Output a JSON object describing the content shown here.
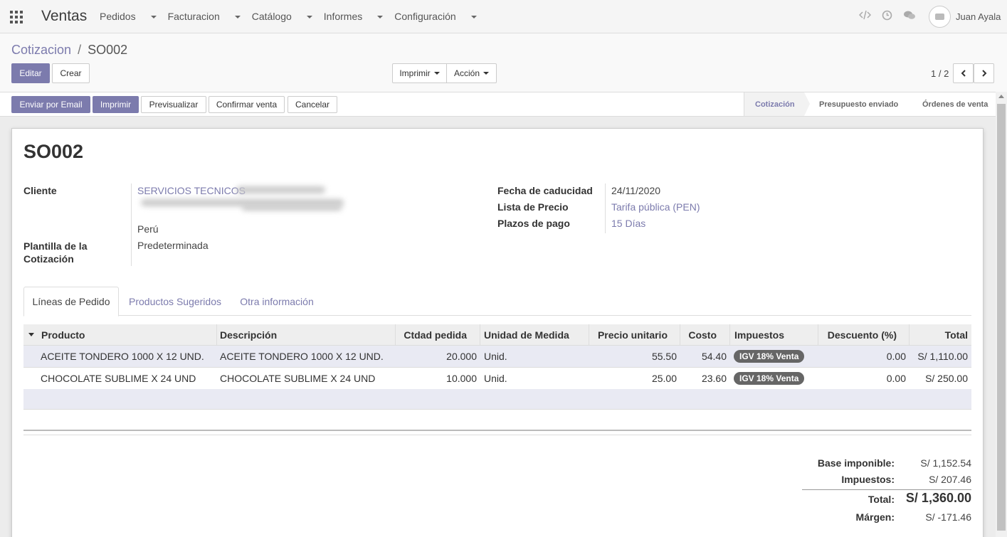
{
  "topbar": {
    "app_name": "Ventas",
    "menu": [
      "Pedidos",
      "Facturacion",
      "Catálogo",
      "Informes",
      "Configuración"
    ],
    "icons": [
      "code-icon",
      "clock-icon",
      "chat-icon"
    ],
    "user_name": "Juan Ayala"
  },
  "breadcrumb": {
    "parent": "Cotizacion",
    "separator": "/",
    "current": "SO002"
  },
  "controls": {
    "edit": "Editar",
    "create": "Crear",
    "print_menu": "Imprimir",
    "action_menu": "Acción",
    "pager": "1 / 2"
  },
  "statusbar": {
    "buttons": [
      "Enviar por Email",
      "Imprimir",
      "Previsualizar",
      "Confirmar venta",
      "Cancelar"
    ],
    "stages": [
      "Cotización",
      "Presupuesto enviado",
      "Órdenes de venta"
    ],
    "active_stage": "Cotización"
  },
  "form": {
    "title": "SO002",
    "client_label": "Cliente",
    "client_name": "SERVICIOS TECNICOS",
    "client_country": "Perú",
    "template_label": "Plantilla de la Cotización",
    "template_value": "Predeterminada",
    "expiry_label": "Fecha de caducidad",
    "expiry_value": "24/11/2020",
    "pricelist_label": "Lista de Precio",
    "pricelist_value": "Tarifa pública (PEN)",
    "payment_terms_label": "Plazos de pago",
    "payment_terms_value": "15 Días"
  },
  "tabs": [
    "Líneas de Pedido",
    "Productos Sugeridos",
    "Otra información"
  ],
  "table": {
    "headers": [
      "Producto",
      "Descripción",
      "Ctdad pedida",
      "Unidad de Medida",
      "Precio unitario",
      "Costo",
      "Impuestos",
      "Descuento (%)",
      "Total"
    ],
    "rows": [
      {
        "product": "ACEITE TONDERO 1000 X 12 UND.",
        "description": "ACEITE TONDERO 1000 X 12 UND.",
        "qty": "20.000",
        "uom": "Unid.",
        "price": "55.50",
        "cost": "54.40",
        "tax": "IGV 18% Venta",
        "discount": "0.00",
        "total": "S/ 1,110.00"
      },
      {
        "product": "CHOCOLATE SUBLIME X 24 UND",
        "description": "CHOCOLATE SUBLIME X 24 UND",
        "qty": "10.000",
        "uom": "Unid.",
        "price": "25.00",
        "cost": "23.60",
        "tax": "IGV 18% Venta",
        "discount": "0.00",
        "total": "S/ 250.00"
      }
    ]
  },
  "totals": {
    "base_label": "Base imponible:",
    "base_value": "S/ 1,152.54",
    "tax_label": "Impuestos:",
    "tax_value": "S/ 207.46",
    "total_label": "Total:",
    "total_value": "S/ 1,360.00",
    "margin_label": "Márgen:",
    "margin_value": "S/ -171.46"
  },
  "colors": {
    "accent": "#7c7bad",
    "badge": "#666666"
  }
}
